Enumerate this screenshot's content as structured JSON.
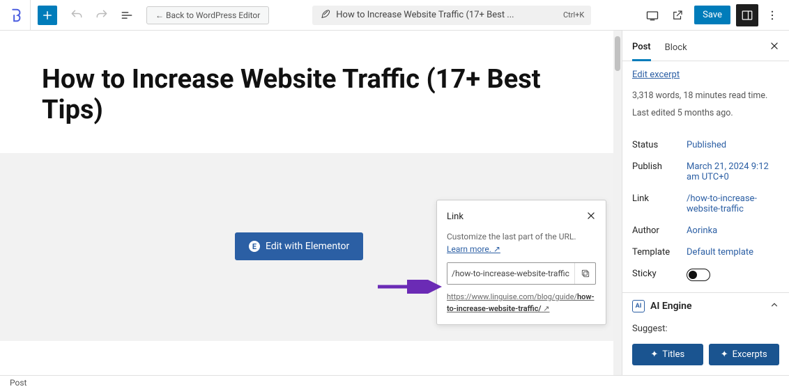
{
  "topbar": {
    "back_label": "← Back to WordPress Editor",
    "doc_title_truncated": "How to Increase Website Traffic (17+ Best ...",
    "shortcut": "Ctrl+K",
    "save_label": "Save"
  },
  "editor": {
    "page_title": "How to Increase Website Traffic (17+ Best Tips)",
    "elementor_button": "Edit with Elementor",
    "elementor_icon_text": "E"
  },
  "link_popover": {
    "title": "Link",
    "description_prefix": "Customize the last part of the URL. ",
    "learn_more": "Learn more. ↗",
    "input_value": "/how-to-increase-website-traffic",
    "full_url_prefix": "https://www.linguise.com/blog/guide/",
    "full_url_bold": "how-to-increase-website-traffic/",
    "full_url_suffix": " ↗"
  },
  "sidebar": {
    "tabs": {
      "post": "Post",
      "block": "Block"
    },
    "edit_excerpt": "Edit excerpt",
    "meta_words": "3,318 words, 18 minutes read time.",
    "meta_edited": "Last edited 5 months ago.",
    "rows": {
      "status": {
        "k": "Status",
        "v": "Published"
      },
      "publish": {
        "k": "Publish",
        "v": "March 21, 2024 9:12 am UTC+0"
      },
      "link": {
        "k": "Link",
        "v": "/how-to-increase-website-traffic"
      },
      "author": {
        "k": "Author",
        "v": "Aorinka"
      },
      "template": {
        "k": "Template",
        "v": "Default template"
      },
      "sticky": {
        "k": "Sticky"
      }
    },
    "ai_engine": {
      "title": "AI Engine",
      "badge": "AI",
      "suggest_label": "Suggest:",
      "titles_btn": "Titles",
      "excerpts_btn": "Excerpts"
    }
  },
  "statusbar": {
    "breadcrumb": "Post"
  }
}
